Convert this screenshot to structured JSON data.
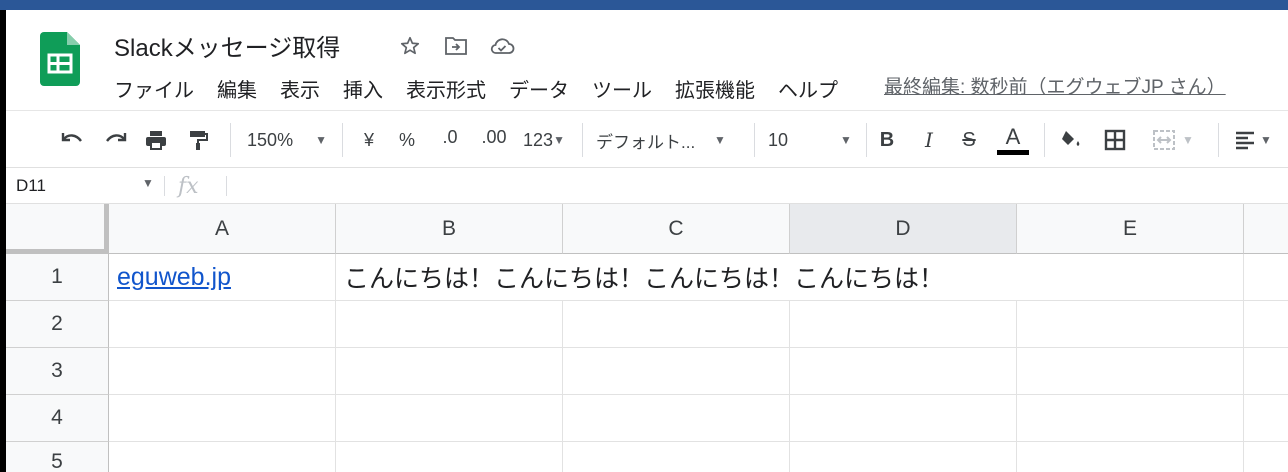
{
  "app": {
    "doc_title": "Slackメッセージ取得",
    "last_edit": "最終編集: 数秒前（エグウェブJP さん）",
    "accent_color": "#2b5797",
    "logo_color": "#0f9d58"
  },
  "menu": [
    "ファイル",
    "編集",
    "表示",
    "挿入",
    "表示形式",
    "データ",
    "ツール",
    "拡張機能",
    "ヘルプ"
  ],
  "toolbar": {
    "zoom": "150%",
    "currency": "¥",
    "percent": "%",
    "decrease_decimal": ".0",
    "increase_decimal": ".00",
    "more_formats": "123",
    "font": "デフォルト...",
    "font_size": "10",
    "bold": "B",
    "italic": "I",
    "strike": "S",
    "text_color": "A"
  },
  "formula_bar": {
    "name_box": "D11",
    "fx_label": "fx",
    "formula": ""
  },
  "sheet": {
    "columns": [
      "A",
      "B",
      "C",
      "D",
      "E"
    ],
    "rows": [
      "1",
      "2",
      "3",
      "4",
      "5"
    ],
    "selected_column": "D",
    "cells": {
      "A1": "eguweb.jp",
      "B1": "こんにちは！こんにちは！こんにちは！こんにちは！"
    }
  }
}
